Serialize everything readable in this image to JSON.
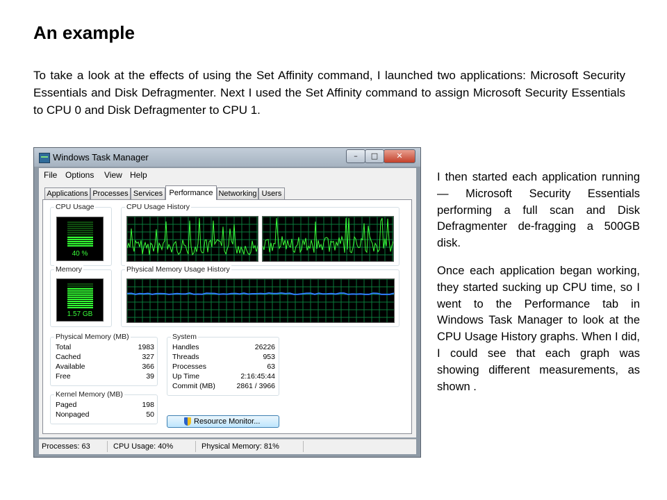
{
  "slide": {
    "title": "An example",
    "intro": "To take a look at the effects of using the Set Affinity command, I launched two applications: Microsoft Security Essentials and Disk Defragmenter. Next I used the Set Affinity command to assign Microsoft Security Essentials to CPU 0 and Disk Defragmenter to CPU 1.",
    "side_paragraph_1": "I then started each application running — Microsoft Security Essentials performing a full scan and Disk Defragmenter de-fragging a 500GB disk.",
    "side_paragraph_2": "Once each application began working, they started sucking up CPU time, so I went to the Performance tab in Windows Task Manager to look at the CPU Usage History graphs. When I did, I could see that each graph was showing different measurements, as shown ."
  },
  "task_manager": {
    "title": "Windows Task Manager",
    "window_buttons": {
      "minimize": "–",
      "maximize": "□",
      "close": "✕"
    },
    "menu": [
      "File",
      "Options",
      "View",
      "Help"
    ],
    "tabs": [
      "Applications",
      "Processes",
      "Services",
      "Performance",
      "Networking",
      "Users"
    ],
    "active_tab": "Performance",
    "cpu_usage": {
      "label": "CPU Usage",
      "value_text": "40 %",
      "level": 0.4
    },
    "cpu_history": {
      "label": "CPU Usage History"
    },
    "memory": {
      "label": "Memory",
      "value_text": "1.57 GB",
      "level": 0.81
    },
    "memory_history": {
      "label": "Physical Memory Usage History"
    },
    "physical_memory": {
      "label": "Physical Memory (MB)",
      "rows": [
        {
          "k": "Total",
          "v": "1983"
        },
        {
          "k": "Cached",
          "v": "327"
        },
        {
          "k": "Available",
          "v": "366"
        },
        {
          "k": "Free",
          "v": "39"
        }
      ]
    },
    "kernel_memory": {
      "label": "Kernel Memory (MB)",
      "rows": [
        {
          "k": "Paged",
          "v": "198"
        },
        {
          "k": "Nonpaged",
          "v": "50"
        }
      ]
    },
    "system": {
      "label": "System",
      "rows": [
        {
          "k": "Handles",
          "v": "26226"
        },
        {
          "k": "Threads",
          "v": "953"
        },
        {
          "k": "Processes",
          "v": "63"
        },
        {
          "k": "Up Time",
          "v": "2:16:45:44"
        },
        {
          "k": "Commit (MB)",
          "v": "2861 / 3966"
        }
      ]
    },
    "resource_monitor_button": "Resource Monitor...",
    "status": {
      "processes": "Processes: 63",
      "cpu": "CPU Usage: 40%",
      "memory": "Physical Memory: 81%"
    },
    "colors": {
      "graph_line": "#3aff3a",
      "grid": "#0a7a3a",
      "memory_line": "#2f7fff"
    }
  }
}
